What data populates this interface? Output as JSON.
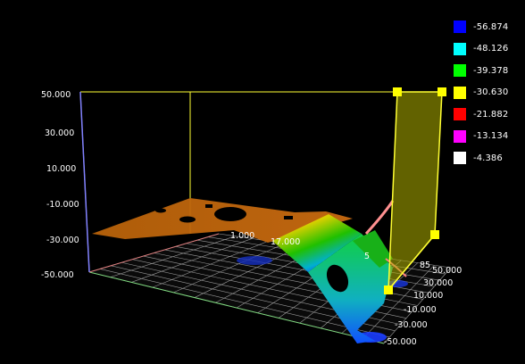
{
  "viewer": {
    "legend": [
      {
        "label": "-56.874",
        "color": "#0000ff"
      },
      {
        "label": "-48.126",
        "color": "#00ffff"
      },
      {
        "label": "-39.378",
        "color": "#00ff00"
      },
      {
        "label": "-30.630",
        "color": "#ffff00"
      },
      {
        "label": "-21.882",
        "color": "#ff0000"
      },
      {
        "label": "-13.134",
        "color": "#ff00ff"
      },
      {
        "label": "-4.386",
        "color": "#ffffff"
      }
    ],
    "z_axis_ticks": [
      "50.000",
      "30.000",
      "10.000",
      "-10.000",
      "-30.000",
      "-50.000"
    ],
    "y_axis_ticks": [
      "50.000",
      "30.000",
      "10.000",
      "-10.000",
      "-30.000",
      "-50.000"
    ],
    "floor_labels": [
      "1.000",
      "17.000",
      "5",
      "85"
    ],
    "colors": {
      "background": "#000000",
      "bounding_box": "#ffff00",
      "clip_plane": "#b3b300",
      "grid": "#bbbbbb"
    }
  }
}
